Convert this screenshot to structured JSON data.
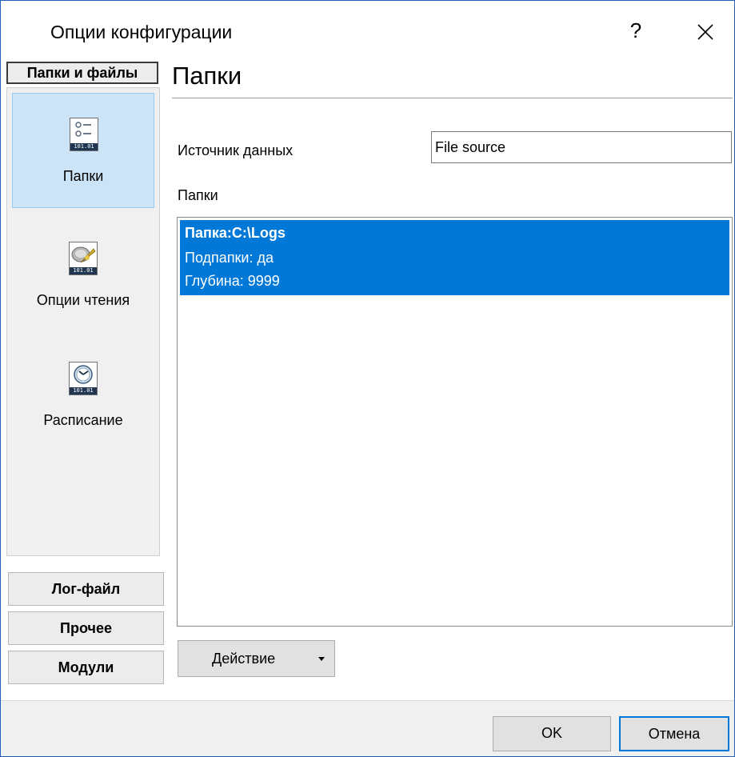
{
  "window": {
    "title": "Опции конфигурации",
    "help_glyph": "?",
    "close_icon": "close-icon"
  },
  "nav": {
    "active_group": "Папки и файлы",
    "items": [
      {
        "label": "Папки",
        "icon": "folder-list-icon",
        "selected": true
      },
      {
        "label": "Опции чтения",
        "icon": "read-options-icon",
        "selected": false
      },
      {
        "label": "Расписание",
        "icon": "clock-icon",
        "selected": false
      }
    ],
    "icon_strip_text": "101.01",
    "groups": [
      "Лог-файл",
      "Прочее",
      "Модули"
    ]
  },
  "content": {
    "page_title": "Папки",
    "datasource_label": "Источник данных",
    "datasource_value": "File source",
    "folders_label": "Папки",
    "folders": [
      {
        "line1": "Папка:C:\\Logs",
        "line2": "Подпапки: да",
        "line3": "Глубина: 9999"
      }
    ],
    "action_button": "Действие"
  },
  "footer": {
    "ok_label": "OK",
    "cancel_label": "Отмена"
  },
  "colors": {
    "selection": "#0078d7",
    "nav_selected": "#cce4f7",
    "window_border": "#1f5fbf"
  }
}
